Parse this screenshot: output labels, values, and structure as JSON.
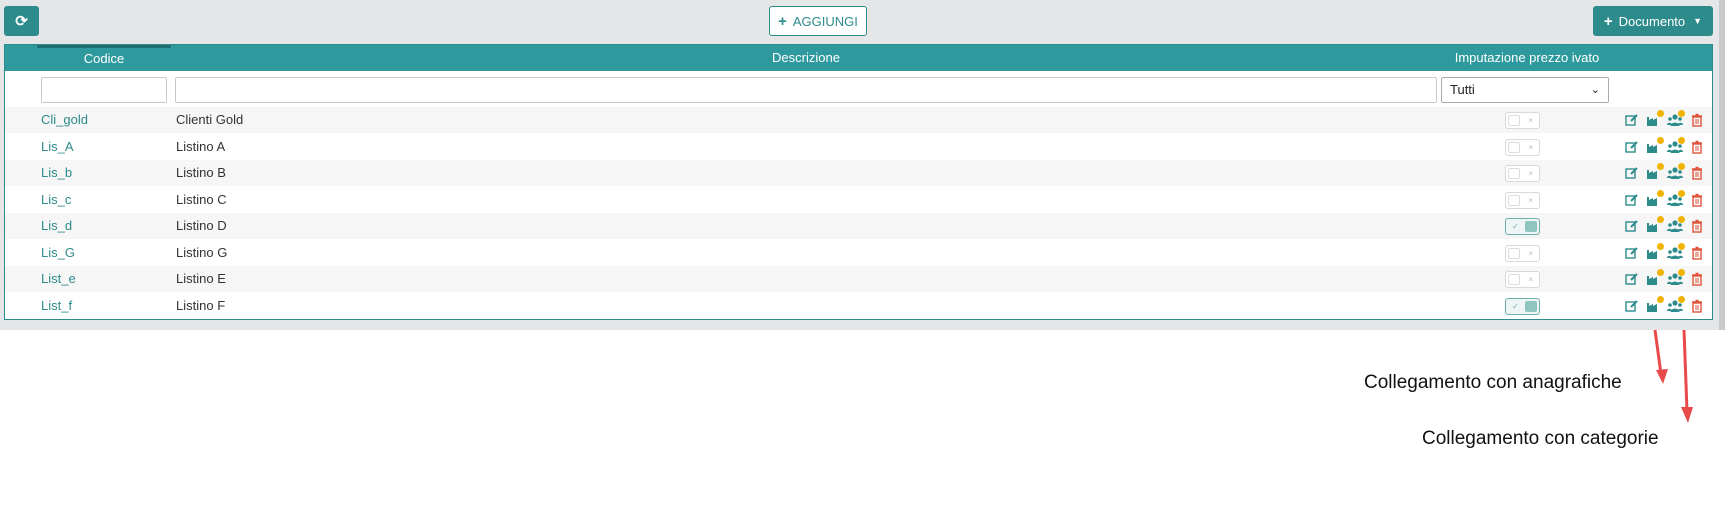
{
  "toolbar": {
    "refresh_icon": "refresh-icon",
    "add_label": "AGGIUNGI",
    "document_label": "Documento"
  },
  "grid": {
    "columns": [
      "Codice",
      "Descrizione",
      "Imputazione prezzo ivato"
    ],
    "filter_select_value": "Tutti",
    "rows": [
      {
        "code": "Cli_gold",
        "desc": "Clienti Gold",
        "vat": false
      },
      {
        "code": "Lis_A",
        "desc": "Listino A",
        "vat": false
      },
      {
        "code": "Lis_b",
        "desc": "Listino B",
        "vat": false
      },
      {
        "code": "Lis_c",
        "desc": "Listino C",
        "vat": false
      },
      {
        "code": "Lis_d",
        "desc": "Listino D",
        "vat": true
      },
      {
        "code": "Lis_G",
        "desc": "Listino G",
        "vat": false
      },
      {
        "code": "List_e",
        "desc": "Listino E",
        "vat": false
      },
      {
        "code": "List_f",
        "desc": "Listino F",
        "vat": true
      }
    ],
    "toggle_off_mark": "×",
    "toggle_on_mark": "✓"
  },
  "annotations": {
    "anagrafiche": "Collegamento con anagrafiche",
    "categorie": "Collegamento con categorie"
  },
  "colors": {
    "accent": "#2e8b8c",
    "header": "#2e9a9d",
    "delete": "#e0533a",
    "badge": "#f0b400",
    "arrow": "#e84a4a"
  }
}
